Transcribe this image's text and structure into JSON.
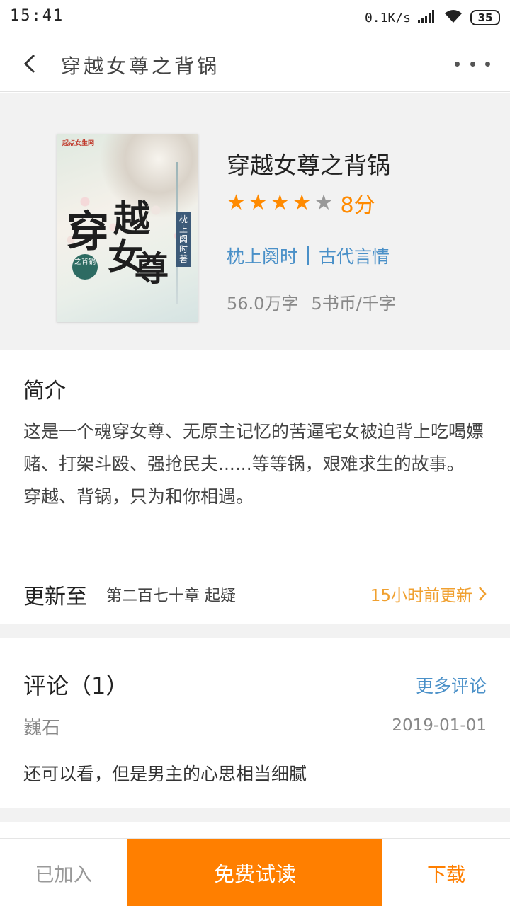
{
  "status_bar": {
    "time": "15:41",
    "net_speed": "0.1K/s",
    "battery": "35"
  },
  "nav": {
    "title": "穿越女尊之背锅"
  },
  "book": {
    "title": "穿越女尊之背锅",
    "stars_filled": 4,
    "stars_total": 5,
    "score": "8分",
    "author": "枕上阕时",
    "category": "古代言情",
    "word_count": "56.0万字",
    "price": "5书币/千字",
    "cover": {
      "logo": "起点女生网",
      "big_title": [
        "穿",
        "越",
        "女",
        "尊"
      ],
      "subtitle": "之背锅",
      "author_tag": "枕上阕时著"
    }
  },
  "intro": {
    "title": "简介",
    "paragraphs": [
      "这是一个魂穿女尊、无原主记忆的苦逼宅女被迫背上吃喝嫖赌、打架斗殴、强抢民夫......等等锅，艰难求生的故事。",
      "穿越、背锅，只为和你相遇。"
    ]
  },
  "update": {
    "label": "更新至",
    "chapter": "第二百七十章 起疑",
    "time": "15小时前更新"
  },
  "comments": {
    "title": "评论（1）",
    "more": "更多评论",
    "items": [
      {
        "user": "巍石",
        "date": "2019-01-01",
        "text": "还可以看，但是男主的心思相当细腻"
      }
    ]
  },
  "bottom_bar": {
    "added": "已加入",
    "read": "免费试读",
    "download": "下载"
  },
  "colors": {
    "accent": "#ff7f00",
    "link": "#4a90c8",
    "update_time": "#f0a030",
    "star_on": "#ff8a00",
    "star_off": "#999999"
  }
}
